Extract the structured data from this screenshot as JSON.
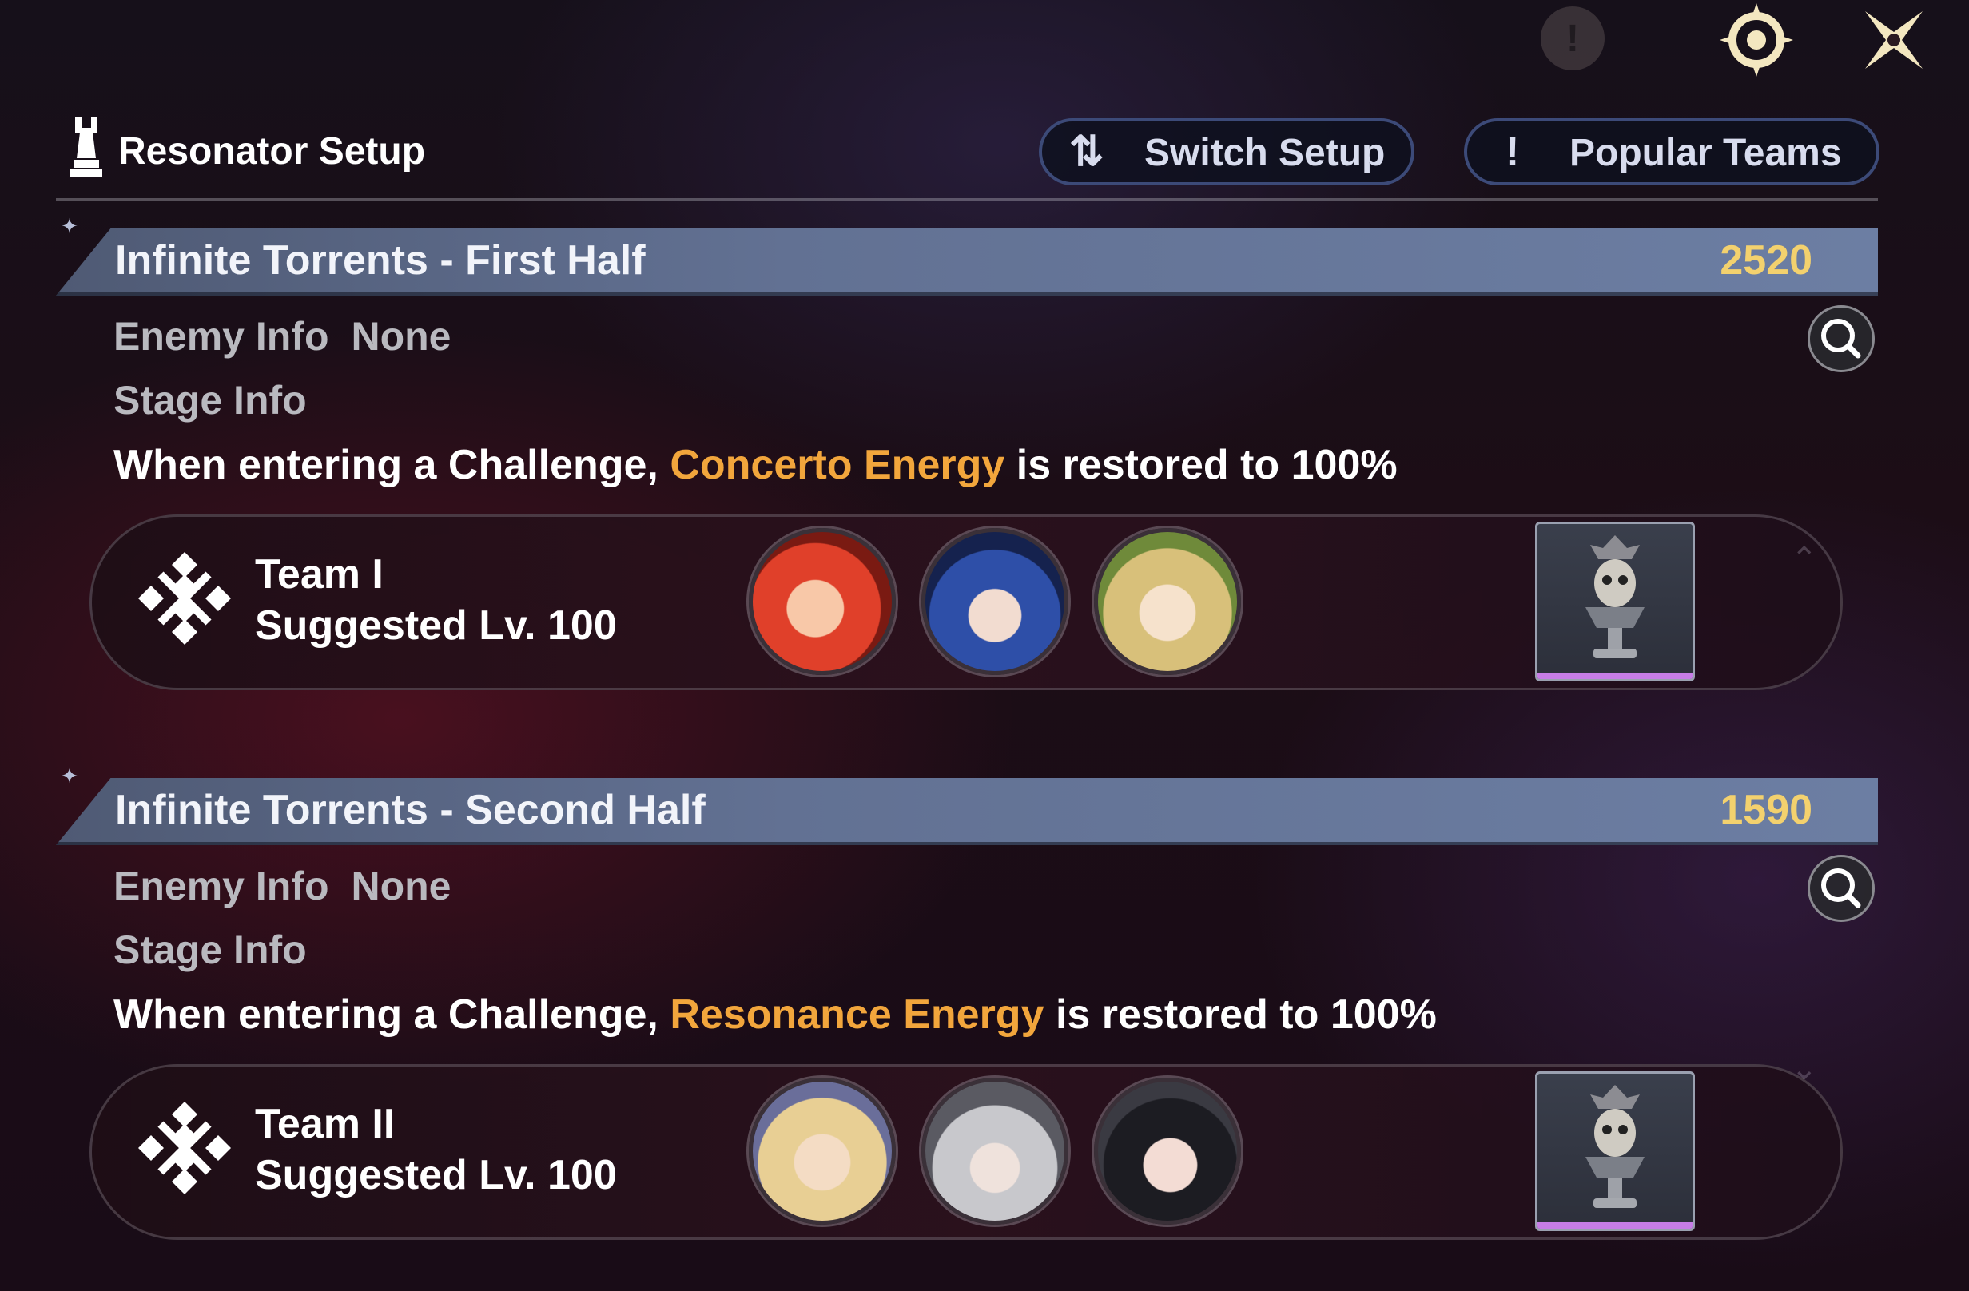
{
  "header": {
    "title": "Resonator Setup",
    "switch_setup": "Switch Setup",
    "popular_teams": "Popular Teams",
    "switch_glyph": "⇅",
    "popular_glyph": "!"
  },
  "top_icons": {
    "info": "!"
  },
  "stages": [
    {
      "title": "Infinite Torrents - First Half",
      "score": "2520",
      "enemy_label": "Enemy Info",
      "enemy_value": "None",
      "stage_label": "Stage Info",
      "desc_prefix": "When entering a Challenge, ",
      "desc_highlight": "Concerto Energy",
      "desc_suffix": " is restored to 100%",
      "team_name": "Team I",
      "team_level": "Suggested Lv. 100",
      "avatars": [
        "red-haired-resonator",
        "blue-haired-resonator",
        "blonde-resonator"
      ]
    },
    {
      "title": "Infinite Torrents - Second Half",
      "score": "1590",
      "enemy_label": "Enemy Info",
      "enemy_value": "None",
      "stage_label": "Stage Info",
      "desc_prefix": "When entering a Challenge, ",
      "desc_highlight": "Resonance Energy",
      "desc_suffix": " is restored to 100%",
      "team_name": "Team II",
      "team_level": "Suggested Lv. 100",
      "avatars": [
        "blonde-crowned-resonator",
        "masked-white-haired-resonator",
        "black-haired-resonator"
      ]
    }
  ],
  "colors": {
    "highlight": "#f2a63c",
    "score": "#f3d16e",
    "stage_bar": "#627193"
  }
}
